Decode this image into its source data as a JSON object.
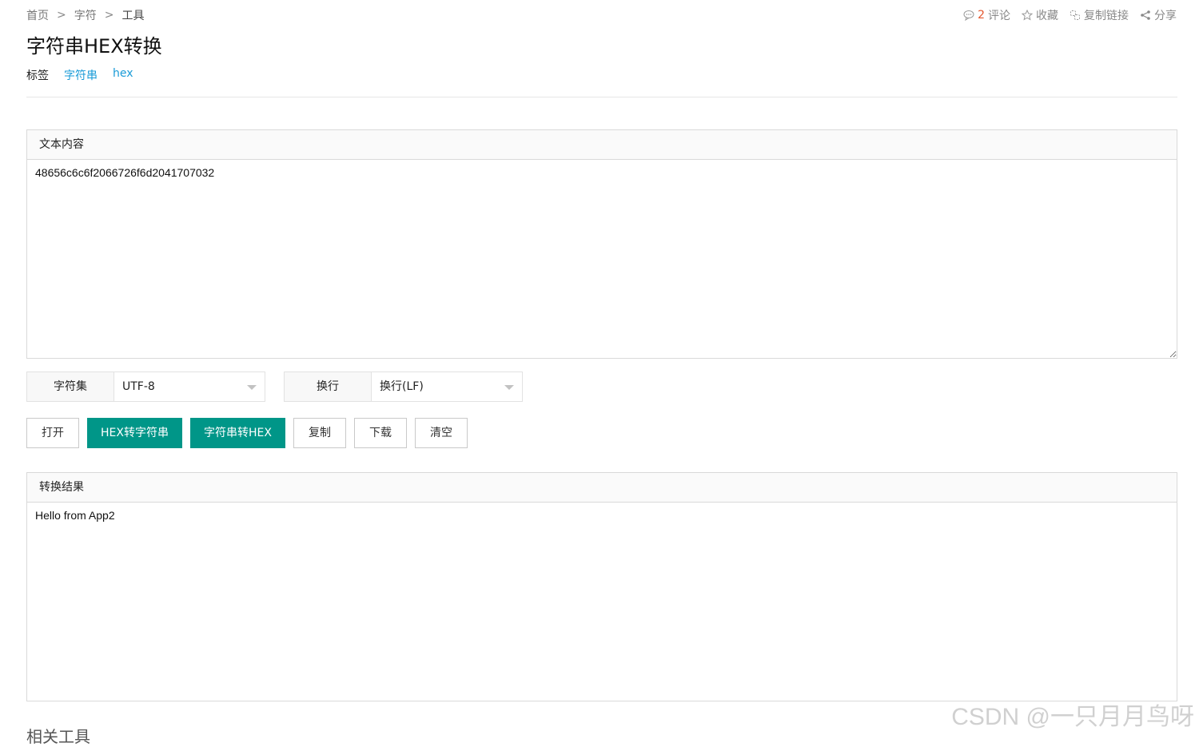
{
  "breadcrumb": {
    "items": [
      "首页",
      "字符",
      "工具"
    ],
    "separator": ">"
  },
  "header_actions": {
    "comment_count": "2",
    "comment_label": "评论",
    "favorite_label": "收藏",
    "copy_link_label": "复制链接",
    "share_label": "分享"
  },
  "page": {
    "title": "字符串HEX转换"
  },
  "tags": {
    "label": "标签",
    "items": [
      "字符串",
      "hex"
    ]
  },
  "input_panel": {
    "header": "文本内容",
    "value": "48656c6c6f2066726f6d2041707032"
  },
  "charset": {
    "label": "字符集",
    "value": "UTF-8"
  },
  "newline": {
    "label": "换行",
    "value": "换行(LF)"
  },
  "buttons": {
    "open": "打开",
    "hex_to_string": "HEX转字符串",
    "string_to_hex": "字符串转HEX",
    "copy": "复制",
    "download": "下载",
    "clear": "清空"
  },
  "output_panel": {
    "header": "转换结果",
    "value": "Hello from App2"
  },
  "related": {
    "title": "相关工具"
  },
  "watermark": "CSDN @一只月月鸟呀",
  "colors": {
    "primary": "#009688",
    "tag_link": "#1a9bd7",
    "comment_count": "#e4572e"
  }
}
